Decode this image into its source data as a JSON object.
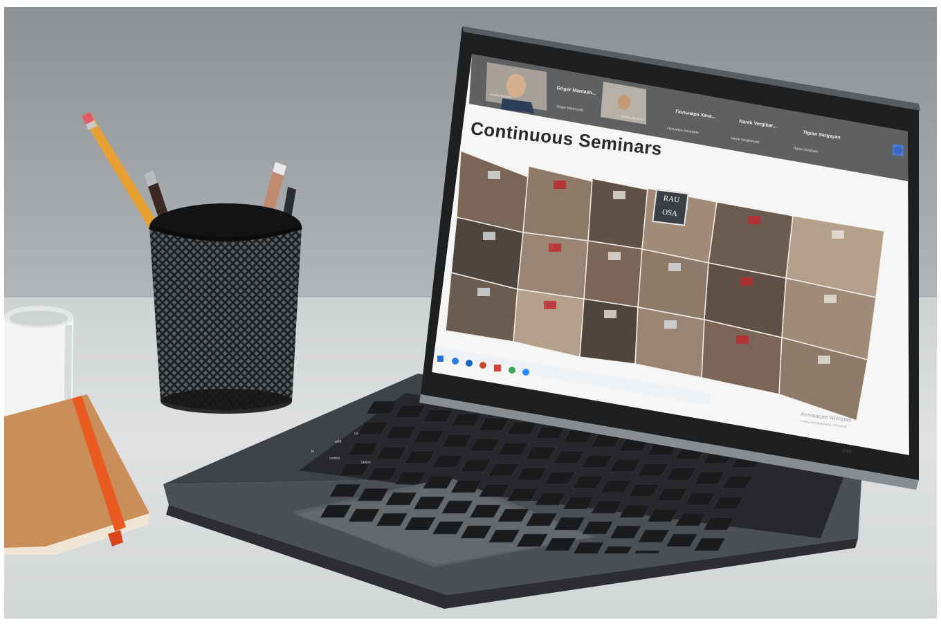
{
  "slide": {
    "title": "Continuous Seminars",
    "logo_line1": "RAU",
    "logo_line2": "OSA"
  },
  "meeting": {
    "participants": [
      {
        "tile_name": "Grigor Mantash...",
        "sub_name": "Grigor Markaryan",
        "self_label": "Andrei Bulykin"
      },
      {
        "tile_name": "Гюльнара Хача...",
        "sub_name": "Гюльнара Хачатрян",
        "self_label": "Andrei Bulykin"
      },
      {
        "tile_name": "Narek Vergibar...",
        "sub_name": "Narek Vergibaryan"
      },
      {
        "tile_name": "Tigran Sargsyan",
        "sub_name": "Tigran Sargsyan"
      }
    ]
  },
  "os": {
    "watermark_title": "Активация Windows",
    "watermark_sub": "Чтобы активировать Windows",
    "tray_language": "ENG"
  },
  "keyboard": {
    "keys": [
      "tab",
      "caps lock",
      "shift",
      "fn",
      "control",
      "option"
    ]
  },
  "colors": {
    "zoom_bar": "#5e6062",
    "slide_bg": "#f7f7f7",
    "accent_red": "#c2272d",
    "laptop_body": "#4a4d50"
  }
}
